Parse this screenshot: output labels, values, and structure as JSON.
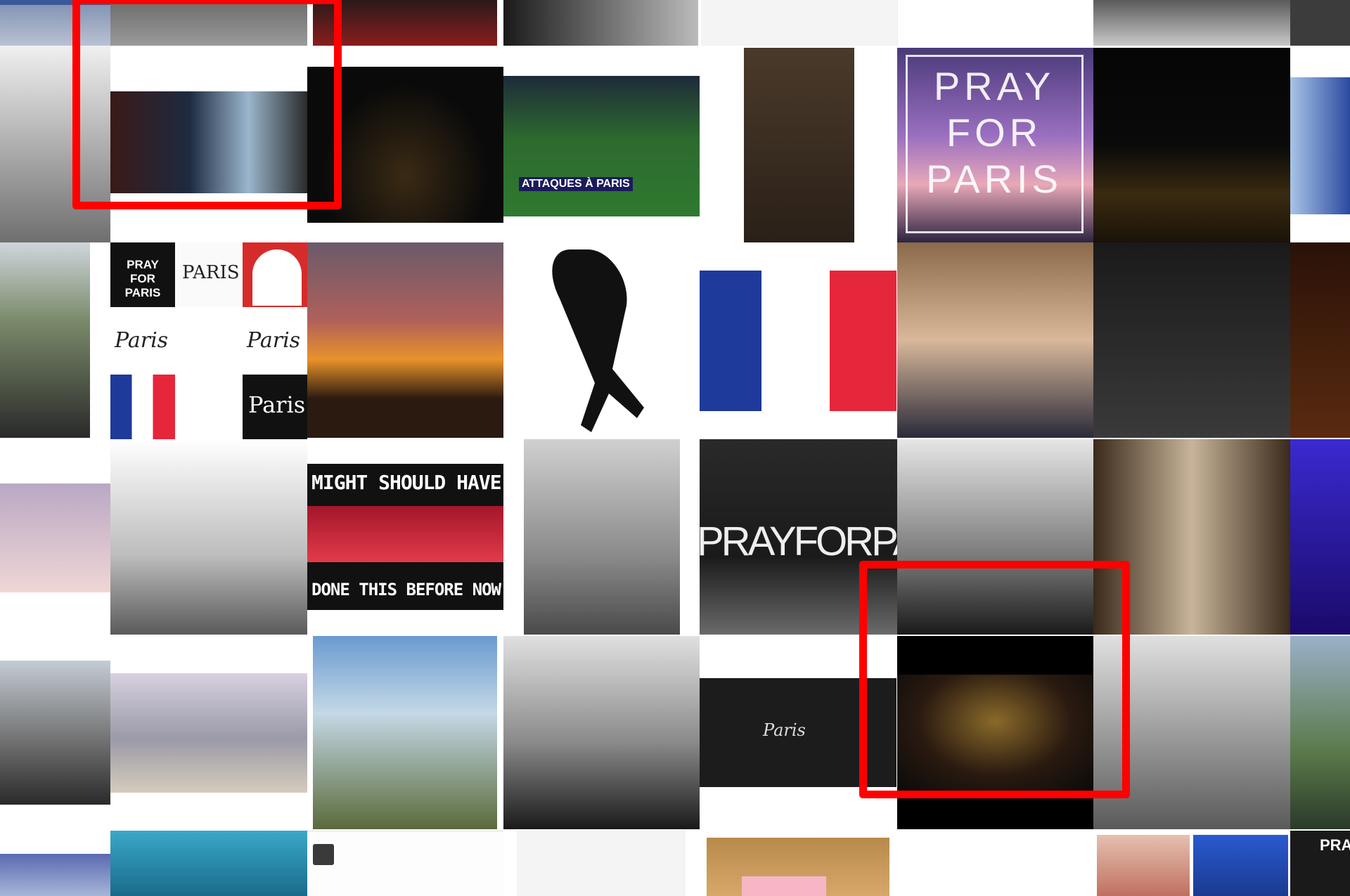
{
  "tiles": {
    "pray_for_paris_poster": "PRAY FOR PARIS",
    "attaques_caption": "ATTAQUES À PARIS",
    "collage_top_left": "PRAY FOR PARIS",
    "collage_paris_1": "PARIS",
    "collage_paris_script_1": "Paris",
    "collage_paris_script_2": "Paris",
    "collage_paris_brush": "Paris",
    "might_should_top": "MIGHT SHOULD HAVE",
    "might_should_bottom": "DONE THIS BEFORE NOW.",
    "prayforparis_banner": "PRAYFORPAR",
    "paris_sign": "Paris",
    "pray_bottom_right": "PRAY"
  },
  "colors": {
    "highlight": "#ff0000",
    "flag_blue": "#1e3a9a",
    "flag_red": "#e6263a"
  }
}
